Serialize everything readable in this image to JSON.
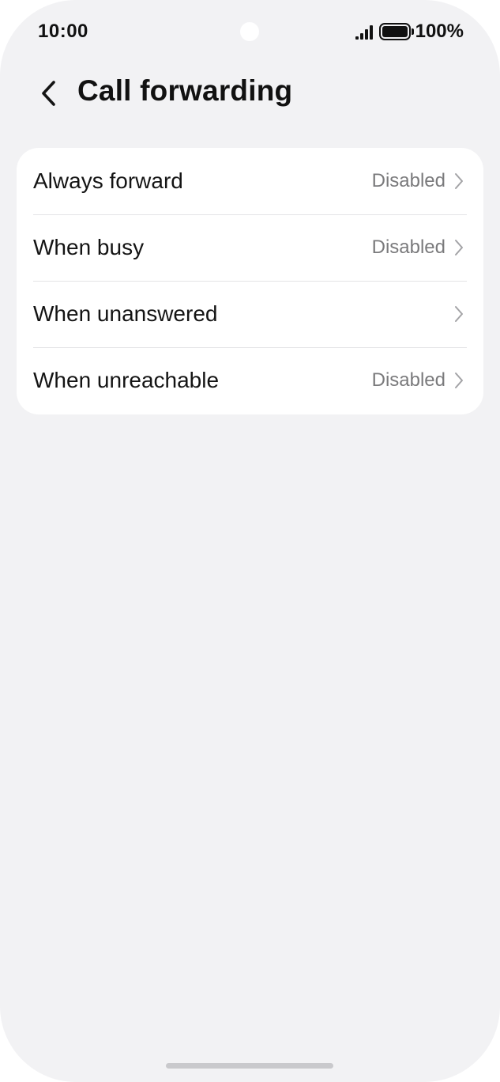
{
  "status_bar": {
    "time": "10:00",
    "battery": "100%"
  },
  "header": {
    "title": "Call forwarding"
  },
  "settings": {
    "items": [
      {
        "label": "Always forward",
        "status": "Disabled"
      },
      {
        "label": "When busy",
        "status": "Disabled"
      },
      {
        "label": "When unanswered",
        "status": ""
      },
      {
        "label": "When unreachable",
        "status": "Disabled"
      }
    ]
  },
  "icons": {
    "back": "back-arrow-icon",
    "chevron": "chevron-right-icon",
    "signal": "signal-icon",
    "battery": "battery-icon"
  },
  "colors": {
    "background": "#f2f2f4",
    "card": "#ffffff",
    "text_primary": "#141414",
    "text_secondary": "#7a7a7c"
  }
}
